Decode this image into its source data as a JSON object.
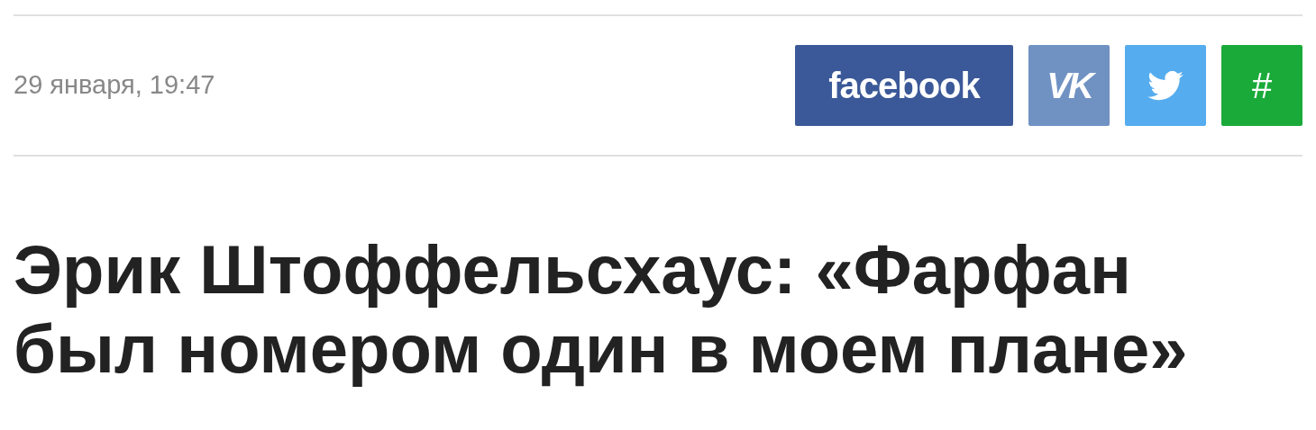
{
  "date": "29 января, 19:47",
  "share_buttons": [
    {
      "kind": "facebook",
      "label": "facebook"
    },
    {
      "kind": "vk",
      "label": "VK"
    },
    {
      "kind": "twitter"
    },
    {
      "kind": "hash",
      "label": "#"
    }
  ],
  "headline": "Эрик Штоффельсхаус: «Фарфан был номером один в моем плане»"
}
